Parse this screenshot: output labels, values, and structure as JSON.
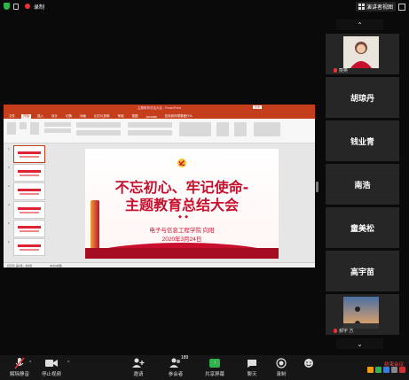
{
  "topbar": {
    "recording_label": "录制",
    "speaker_view_label": "演讲者视图"
  },
  "shared_screen": {
    "ppt_window_title": "主题教育总结大会 - PowerPoint",
    "login_label": "登录",
    "ribbon_tabs": [
      "文件",
      "开始",
      "插入",
      "设计",
      "切换",
      "动画",
      "幻灯片放映",
      "审阅",
      "视图",
      "Acrobat",
      "告诉我你想要做什么"
    ],
    "active_tab": "开始",
    "thumbnail_numbers": [
      "1",
      "2",
      "3",
      "4",
      "5",
      "6"
    ],
    "slide": {
      "title_line1": "不忘初心、牢记使命-",
      "title_line2": "主题教育总结大会",
      "diamonds": "◆ ◆",
      "subtitle_line1": "电子与信息工程学院  向阳",
      "subtitle_line2": "2020年3月24日"
    },
    "status": {
      "slide_count": "幻灯片 第1张，共6张",
      "language": "中文(中国)"
    }
  },
  "gallery": {
    "tiles": [
      {
        "name": "",
        "caption": "丽英",
        "has_video": true
      },
      {
        "name": "胡琼丹",
        "caption": ""
      },
      {
        "name": "钱业青",
        "caption": ""
      },
      {
        "name": "南浩",
        "caption": ""
      },
      {
        "name": "童美松",
        "caption": ""
      },
      {
        "name": "高宇苗",
        "caption": ""
      },
      {
        "name": "",
        "caption": "郝宇 方",
        "has_video": true
      }
    ]
  },
  "toolbar": {
    "unmute_label": "解除静音",
    "stop_video_label": "停止视频",
    "invite_label": "邀请",
    "participants_label": "参会者",
    "participants_count": "189",
    "share_screen_label": "共享屏幕",
    "chat_label": "聊天",
    "record_label": "录制",
    "reactions_label": "",
    "end_meeting_label": "结束会议"
  },
  "colors": {
    "ppt_red": "#c43e1c",
    "slide_red": "#c8102e",
    "share_green": "#2fb34a",
    "end_red": "#f44"
  }
}
